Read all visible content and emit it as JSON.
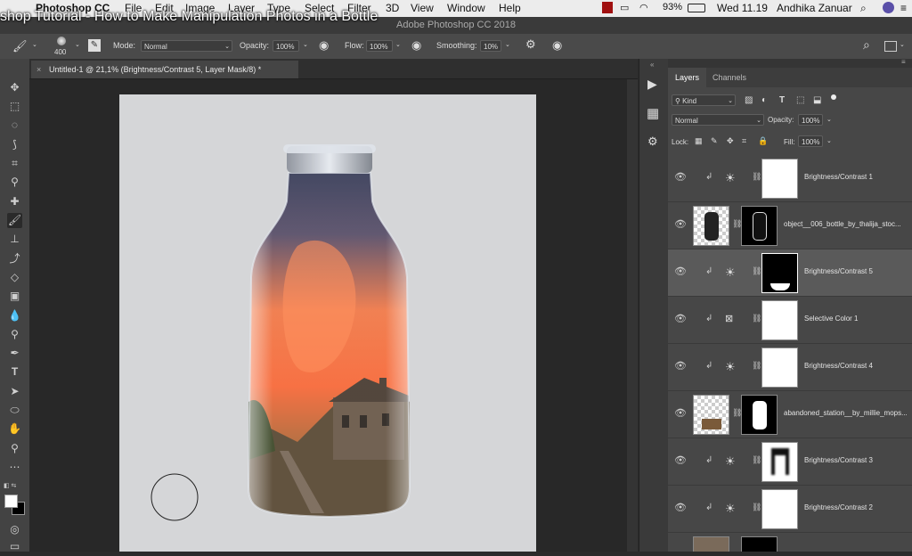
{
  "video_title": "shop Tutorial - How to Make Manipulation Photos in a Bottle",
  "menubar": {
    "app": "Photoshop CC",
    "items": [
      "File",
      "Edit",
      "Image",
      "Layer",
      "Type",
      "Select",
      "Filter",
      "3D",
      "View",
      "Window",
      "Help"
    ],
    "battery": "93%",
    "clock": "Wed 11.19",
    "user": "Andhika Zanuar"
  },
  "window_title": "Adobe Photoshop CC 2018",
  "options": {
    "brush_size": "400",
    "mode_label": "Mode:",
    "mode_value": "Normal",
    "opacity_label": "Opacity:",
    "opacity_value": "100%",
    "flow_label": "Flow:",
    "flow_value": "100%",
    "smoothing_label": "Smoothing:",
    "smoothing_value": "10%"
  },
  "document_tab": "Untitled-1 @ 21,1% (Brightness/Contrast 5, Layer Mask/8) *",
  "layers_panel": {
    "tabs": [
      "Layers",
      "Channels"
    ],
    "filter_kind": "Kind",
    "blend_mode": "Normal",
    "opacity_label": "Opacity:",
    "opacity_value": "100%",
    "lock_label": "Lock:",
    "fill_label": "Fill:",
    "fill_value": "100%",
    "layers": [
      {
        "name": "Brightness/Contrast 1",
        "type": "adjustment",
        "selected": false
      },
      {
        "name": "object__006_bottle_by_thalija_stoc...",
        "type": "image",
        "selected": false
      },
      {
        "name": "Brightness/Contrast 5",
        "type": "adjustment",
        "selected": true
      },
      {
        "name": "Selective Color 1",
        "type": "adjustment",
        "selected": false
      },
      {
        "name": "Brightness/Contrast 4",
        "type": "adjustment",
        "selected": false
      },
      {
        "name": "abandoned_station__by_millie_mops...",
        "type": "image",
        "selected": false
      },
      {
        "name": "Brightness/Contrast 3",
        "type": "adjustment",
        "selected": false
      },
      {
        "name": "Brightness/Contrast 2",
        "type": "adjustment",
        "selected": false
      }
    ]
  }
}
